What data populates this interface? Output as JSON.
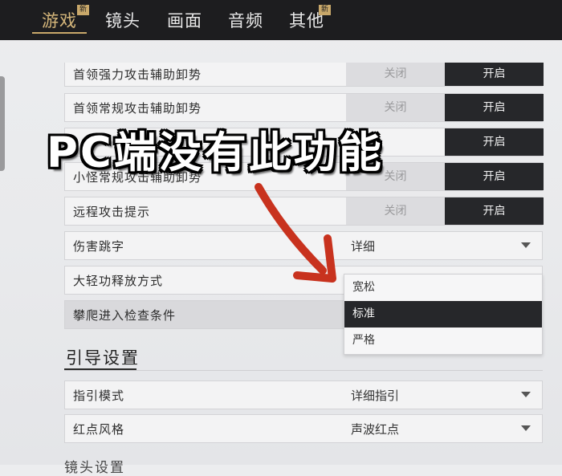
{
  "tabs": [
    {
      "label": "游戏",
      "badge": "新",
      "active": true
    },
    {
      "label": "镜头"
    },
    {
      "label": "画面"
    },
    {
      "label": "音频"
    },
    {
      "label": "其他",
      "badge": "新"
    }
  ],
  "settings": [
    {
      "label": "首领强力攻击辅助卸势",
      "off": "关闭",
      "on": "开启"
    },
    {
      "label": "首领常规攻击辅助卸势",
      "off": "关闭",
      "on": "开启"
    },
    {
      "label": "",
      "on": "开启"
    },
    {
      "label": "小怪常规攻击辅助卸势",
      "off": "关闭",
      "on": "开启"
    },
    {
      "label": "远程攻击提示",
      "off": "关闭",
      "on": "开启"
    },
    {
      "label": "伤害跳字",
      "value": "详细"
    },
    {
      "label": "大轻功释放方式"
    },
    {
      "label": "攀爬进入检查条件"
    }
  ],
  "dropdown": {
    "options": [
      "宽松",
      "标准",
      "严格"
    ],
    "selected": "标准"
  },
  "guide_section": {
    "title": "引导设置"
  },
  "guide_settings": [
    {
      "label": "指引模式",
      "value": "详细指引"
    },
    {
      "label": "红点风格",
      "value": "声波红点"
    }
  ],
  "overlay_caption": "PC端没有此功能",
  "bottom_partial": "镜头设置"
}
